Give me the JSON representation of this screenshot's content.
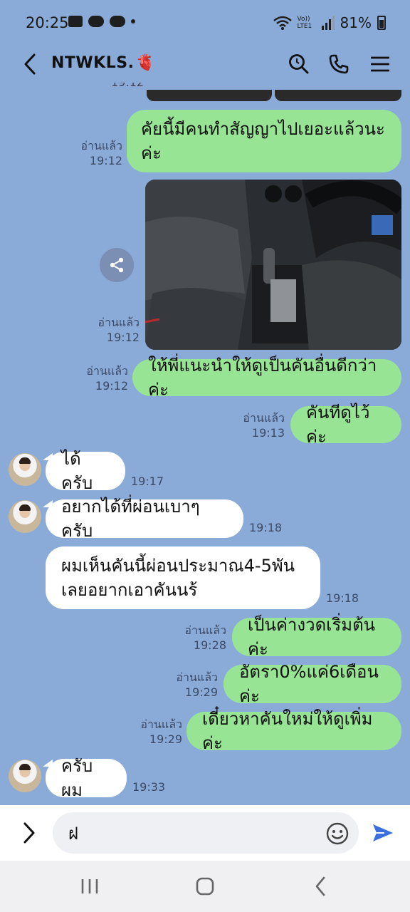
{
  "status_bar": {
    "time": "20:25",
    "network": "Vo)) LTE1",
    "battery": "81%"
  },
  "header": {
    "contact_name": "NTWKLS.",
    "heart_emoji": "🫀",
    "icons": [
      "back-icon",
      "search-icon",
      "phone-icon",
      "menu-icon"
    ]
  },
  "chat": {
    "previous_time": "19:12",
    "messages": [
      {
        "dir": "out",
        "text": "คัยนี้มีคนทำสัญญาไปเยอะแล้วนะค่ะ",
        "read": "อ่านแล้ว",
        "time": "19:12"
      },
      {
        "dir": "out",
        "type": "image",
        "read": "อ่านแล้ว",
        "time": "19:12"
      },
      {
        "dir": "out",
        "text": "ให้พี่แนะนำให้ดูเป็นคันอื่นดีกว่าค่ะ",
        "read": "อ่านแล้ว",
        "time": "19:12"
      },
      {
        "dir": "out",
        "text": "คันทีดูไว้ค่ะ",
        "read": "อ่านแล้ว",
        "time": "19:13"
      },
      {
        "dir": "in",
        "text": "ได้ครับ",
        "time": "19:17"
      },
      {
        "dir": "in",
        "text": "อยากได้ที่ผ่อนเบาๆครับ",
        "time": "19:18"
      },
      {
        "dir": "in",
        "line1": "ผมเห็นคันนี้ผ่อนประมาณ4-5พัน",
        "line2": "เลยอยากเอาคันนร้",
        "time": "19:18"
      },
      {
        "dir": "out",
        "text": "เป็นค่างวดเริ่มต้นค่ะ",
        "read": "อ่านแล้ว",
        "time": "19:28"
      },
      {
        "dir": "out",
        "text": "อัตรา0%แค่6เดือนค่ะ",
        "read": "อ่านแล้ว",
        "time": "19:29"
      },
      {
        "dir": "out",
        "text": "เดี๋ยวหาคันใหม่ให้ดูเพิ่มค่ะ",
        "read": "อ่านแล้ว",
        "time": "19:29"
      },
      {
        "dir": "in",
        "text": "ครับผม",
        "time": "19:33"
      }
    ],
    "first_line1": "คัยนี้มีคนทำสัญญาไปเยอะแล้วนะ",
    "first_line2": "ค่ะ"
  },
  "input": {
    "value": "ฝ",
    "icons": [
      "chevron-right-icon",
      "emoji-icon",
      "send-icon"
    ]
  },
  "nav": {
    "icons": [
      "recents-icon",
      "home-icon",
      "back-nav-icon"
    ]
  },
  "colors": {
    "background": "#8aaad8",
    "outgoing_bubble": "#98e495",
    "incoming_bubble": "#ffffff",
    "send_icon": "#3b6fe0"
  }
}
